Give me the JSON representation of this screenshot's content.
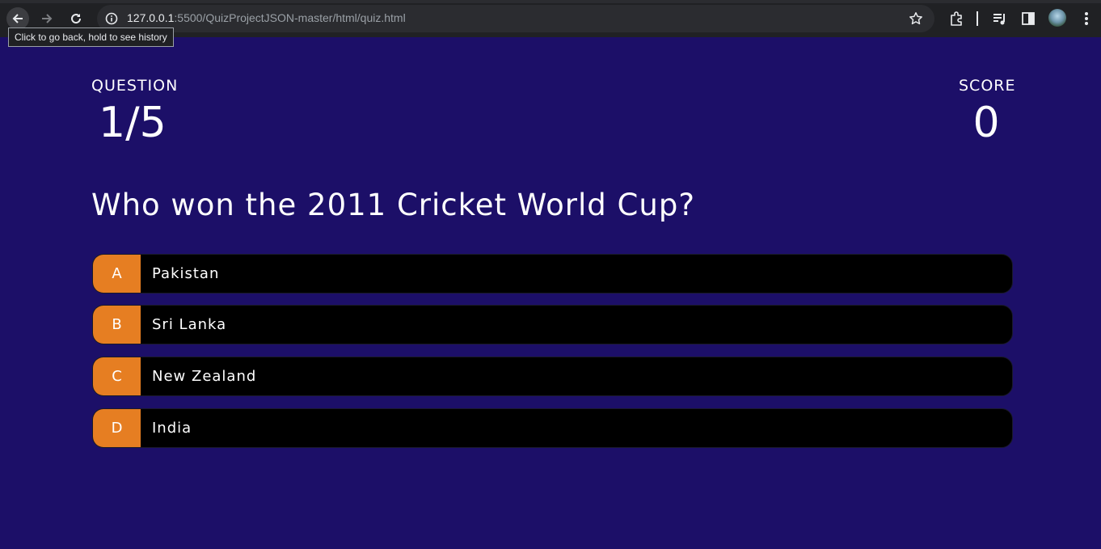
{
  "browser": {
    "url_host": "127.0.0.1",
    "url_rest": ":5500/QuizProjectJSON-master/html/quiz.html",
    "tooltip": "Click to go back, hold to see history"
  },
  "hud": {
    "question_label": "QUESTION",
    "question_progress": "1/5",
    "score_label": "SCORE",
    "score_value": "0"
  },
  "question": {
    "text": "Who won the 2011 Cricket World Cup?"
  },
  "choices": [
    {
      "prefix": "A",
      "text": "Pakistan"
    },
    {
      "prefix": "B",
      "text": "Sri Lanka"
    },
    {
      "prefix": "C",
      "text": "New Zealand"
    },
    {
      "prefix": "D",
      "text": "India"
    }
  ],
  "colors": {
    "background": "#1c0f68",
    "choice_prefix": "#e67e22",
    "choice_body": "#000000"
  },
  "icons": [
    "back-arrow-icon",
    "forward-arrow-icon",
    "reload-icon",
    "info-icon",
    "star-icon",
    "extensions-icon",
    "media-queue-icon",
    "side-panel-icon",
    "profile-avatar",
    "menu-dots-icon"
  ]
}
